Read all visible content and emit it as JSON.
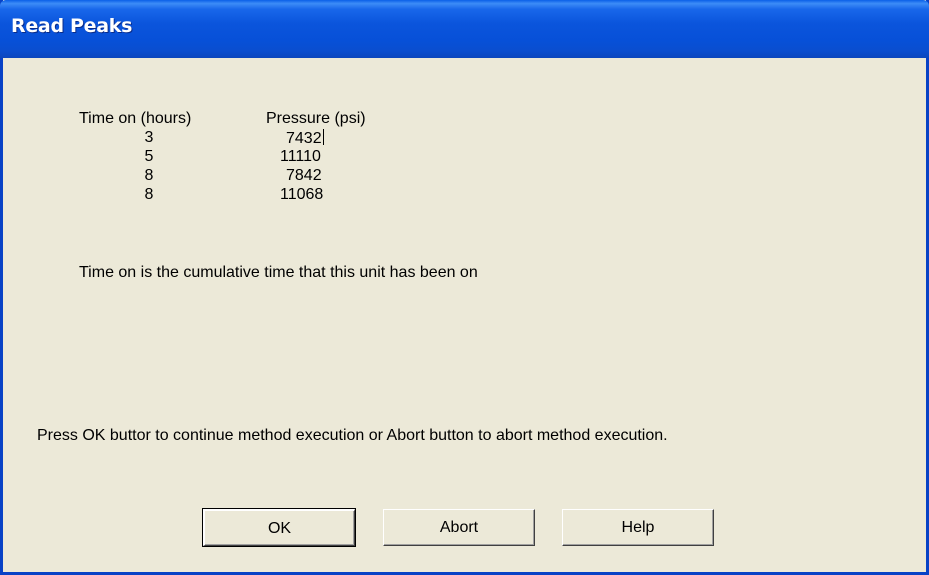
{
  "window": {
    "title": "Read Peaks"
  },
  "table": {
    "headers": {
      "time": "Time on (hours)",
      "pressure": "Pressure (psi)"
    },
    "rows": [
      {
        "time": "3",
        "pressure": "7432"
      },
      {
        "time": "5",
        "pressure": "11110"
      },
      {
        "time": "8",
        "pressure": "7842"
      },
      {
        "time": "8",
        "pressure": "11068"
      }
    ]
  },
  "note": "Time on is the cumulative time that this unit has been on",
  "instruction": "Press OK buttor to continue method execution or Abort button to abort method execution.",
  "buttons": {
    "ok": "OK",
    "abort": "Abort",
    "help": "Help"
  },
  "colors": {
    "titlebar": "#0b55dc",
    "dialog_background": "#ece9d8",
    "title_text": "#ffffff"
  }
}
